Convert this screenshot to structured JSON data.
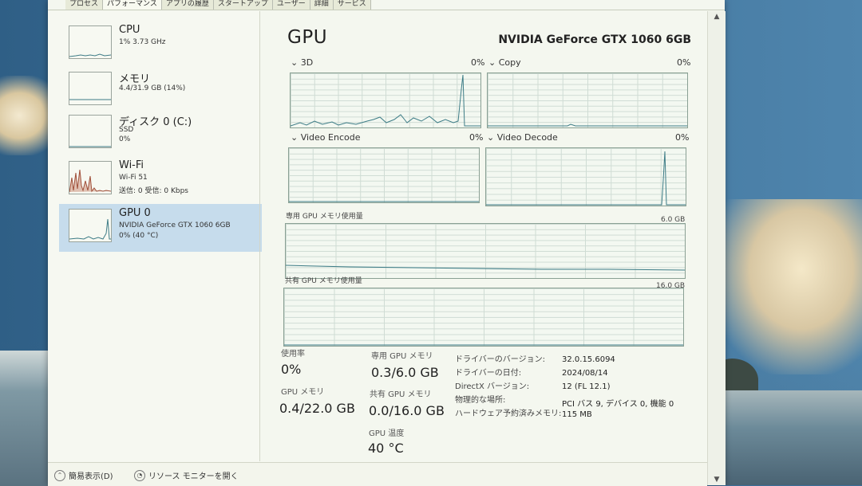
{
  "tabs": [
    "プロセス",
    "パフォーマンス",
    "アプリの履歴",
    "スタートアップ",
    "ユーザー",
    "詳細",
    "サービス"
  ],
  "devices": [
    {
      "name": "CPU",
      "lines": [
        "1% 3.73 GHz"
      ]
    },
    {
      "name": "メモリ",
      "lines": [
        "4.4/31.9 GB (14%)"
      ]
    },
    {
      "name": "ディスク 0 (C:)",
      "lines": [
        "SSD",
        "0%"
      ]
    },
    {
      "name": "Wi-Fi",
      "lines": [
        "Wi-Fi 51",
        "送信: 0 受信: 0 Kbps"
      ]
    },
    {
      "name": "GPU 0",
      "lines": [
        "NVIDIA GeForce GTX 1060 6GB",
        "0% (40 °C)"
      ]
    }
  ],
  "selected_device": "GPU 0",
  "main": {
    "title": "GPU",
    "model": "NVIDIA GeForce GTX 1060 6GB",
    "engines": [
      {
        "name": "3D",
        "percent": "0%"
      },
      {
        "name": "Copy",
        "percent": "0%"
      },
      {
        "name": "Video Encode",
        "percent": "0%"
      },
      {
        "name": "Video Decode",
        "percent": "0%"
      }
    ],
    "dedicated_label": "専用 GPU メモリ使用量",
    "dedicated_max": "6.0 GB",
    "shared_label": "共有 GPU メモリ使用量",
    "shared_max": "16.0 GB"
  },
  "stats": {
    "utilization_label": "使用率",
    "utilization_value": "0%",
    "dedicated_label": "専用 GPU メモリ",
    "dedicated_value": "0.3/6.0 GB",
    "gpu_mem_label": "GPU メモリ",
    "gpu_mem_value": "0.4/22.0 GB",
    "shared_label": "共有 GPU メモリ",
    "shared_value": "0.0/16.0 GB",
    "temp_label": "GPU 温度",
    "temp_value": "40 °C"
  },
  "info": [
    {
      "key": "ドライバーのバージョン:",
      "value": "32.0.15.6094"
    },
    {
      "key": "ドライバーの日付:",
      "value": "2024/08/14"
    },
    {
      "key": "DirectX バージョン:",
      "value": "12 (FL 12.1)"
    },
    {
      "key": "物理的な場所:",
      "value": "PCI バス 9, デバイス 0, 機能 0"
    },
    {
      "key": "ハードウェア予約済みメモリ:",
      "value": "115 MB"
    }
  ],
  "footer": {
    "fewer_details": "簡易表示(D)",
    "resource_monitor": "リソース モニターを開く"
  },
  "colors": {
    "selected_bg": "#c6dcec",
    "graph_line": "#3d7c86",
    "graph_grid": "#cfdcd4"
  }
}
